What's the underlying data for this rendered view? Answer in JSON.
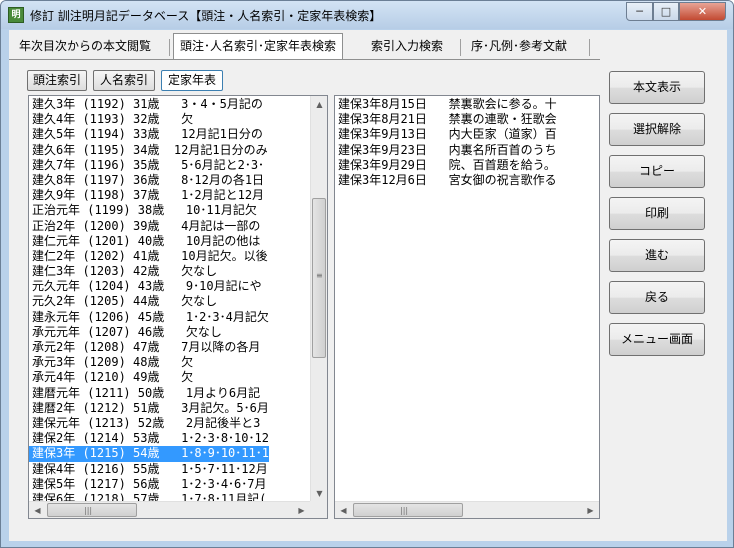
{
  "window": {
    "title": "修訂 訓注明月記データベース【頭注・人名索引・定家年表検索】",
    "min_glyph": "─",
    "max_glyph": "□",
    "close_glyph": "✕"
  },
  "tabs": [
    {
      "label": "年次目次からの本文閲覧"
    },
    {
      "label": "頭注･人名索引･定家年表検索"
    },
    {
      "label": "索引入力検索"
    },
    {
      "label": "序･凡例･参考文献"
    }
  ],
  "sub_buttons": [
    {
      "label": "頭注索引"
    },
    {
      "label": "人名索引"
    },
    {
      "label": "定家年表"
    }
  ],
  "left_list": {
    "selected_index": 23,
    "rows": [
      "建久3年 (1192) 31歳   3・4・5月記の",
      "建久4年 (1193) 32歳   欠",
      "建久5年 (1194) 33歳   12月記1日分の",
      "建久6年 (1195) 34歳  12月記1日分のみ",
      "建久7年 (1196) 35歳   5･6月記と2･3･",
      "建久8年 (1197) 36歳   8･12月の各1日",
      "建久9年 (1198) 37歳   1･2月記と12月",
      "正治元年 (1199) 38歳   10･11月記欠",
      "正治2年 (1200) 39歳   4月記は一部の",
      "建仁元年 (1201) 40歳   10月記の他は",
      "建仁2年 (1202) 41歳   10月記欠。以後",
      "建仁3年 (1203) 42歳   欠なし",
      "元久元年 (1204) 43歳   9･10月記にや",
      "元久2年 (1205) 44歳   欠なし",
      "建永元年 (1206) 45歳   1･2･3･4月記欠",
      "承元元年 (1207) 46歳   欠なし",
      "承元2年 (1208) 47歳   7月以降の各月",
      "承元3年 (1209) 48歳   欠",
      "承元4年 (1210) 49歳   欠",
      "建暦元年 (1211) 50歳   1月より6月記",
      "建暦2年 (1212) 51歳   3月記欠。5･6月",
      "建保元年 (1213) 52歳   2月記後半と3",
      "建保2年 (1214) 53歳   1･2･3･8･10･12",
      "建保3年 (1215) 54歳   1･8･9･10･11･1",
      "建保4年 (1216) 55歳   1･5･7･11･12月",
      "建保5年 (1217) 56歳   1･2･3･4･6･7月",
      "建保6年 (1218) 57歳   1･7･8･11月記("
    ]
  },
  "right_list": {
    "rows": [
      "建保3年8月15日   禁裏歌会に参る。十",
      "建保3年8月21日   禁裏の連歌・狂歌会",
      "建保3年9月13日   内大臣家（道家）百",
      "建保3年9月23日   内裏名所百首のうち",
      "建保3年9月29日   院、百首題を給う。",
      "建保3年12月6日   宮女御の祝言歌作る"
    ]
  },
  "side_buttons": [
    {
      "label": "本文表示"
    },
    {
      "label": "選択解除"
    },
    {
      "label": "コピー"
    },
    {
      "label": "印刷"
    },
    {
      "label": "進む"
    },
    {
      "label": "戻る"
    },
    {
      "label": "メニュー画面"
    }
  ],
  "scroll_glyphs": {
    "up": "▲",
    "down": "▼",
    "left": "◀",
    "right": "▶",
    "vgrip": "≡",
    "hgrip": "|||"
  }
}
